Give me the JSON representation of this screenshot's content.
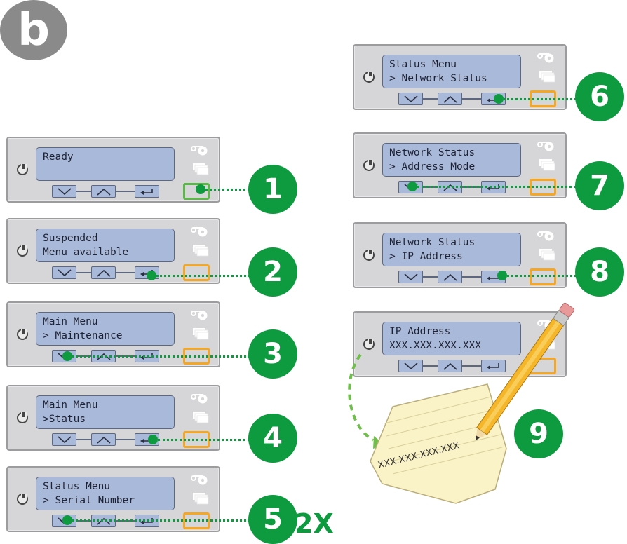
{
  "figure_label": "b",
  "panels": [
    {
      "line1": "Ready",
      "line2": "",
      "step": "1"
    },
    {
      "line1": "Suspended",
      "line2": "Menu available",
      "step": "2"
    },
    {
      "line1": "Main Menu",
      "line2": "> Maintenance",
      "step": "3"
    },
    {
      "line1": "Main Menu",
      "line2": ">Status",
      "step": "4"
    },
    {
      "line1": "Status Menu",
      "line2": "> Serial Number",
      "step": "5",
      "repeat": "2X"
    },
    {
      "line1": "Status Menu",
      "line2": "> Network Status",
      "step": "6"
    },
    {
      "line1": "Network Status",
      "line2": "> Address Mode",
      "step": "7"
    },
    {
      "line1": "Network Status",
      "line2": "> IP Address",
      "step": "8"
    },
    {
      "line1": "IP Address",
      "line2": "XXX.XXX.XXX.XXX"
    }
  ],
  "final_step": "9",
  "note_text": "XXX.XXX.XXX.XXX",
  "colors": {
    "step_green": "#0e9a3f",
    "highlight_orange": "#f5a623",
    "highlight_green": "#5ab847",
    "lcd_blue": "#a9b9d9",
    "panel_gray": "#d6d6d8",
    "badge_gray": "#8a8a8a"
  },
  "icons": [
    "power-icon",
    "down-arrow-icon",
    "up-arrow-icon",
    "enter-icon",
    "ribbon-icon",
    "card-stack-icon",
    "pencil-icon",
    "notepaper-icon"
  ]
}
